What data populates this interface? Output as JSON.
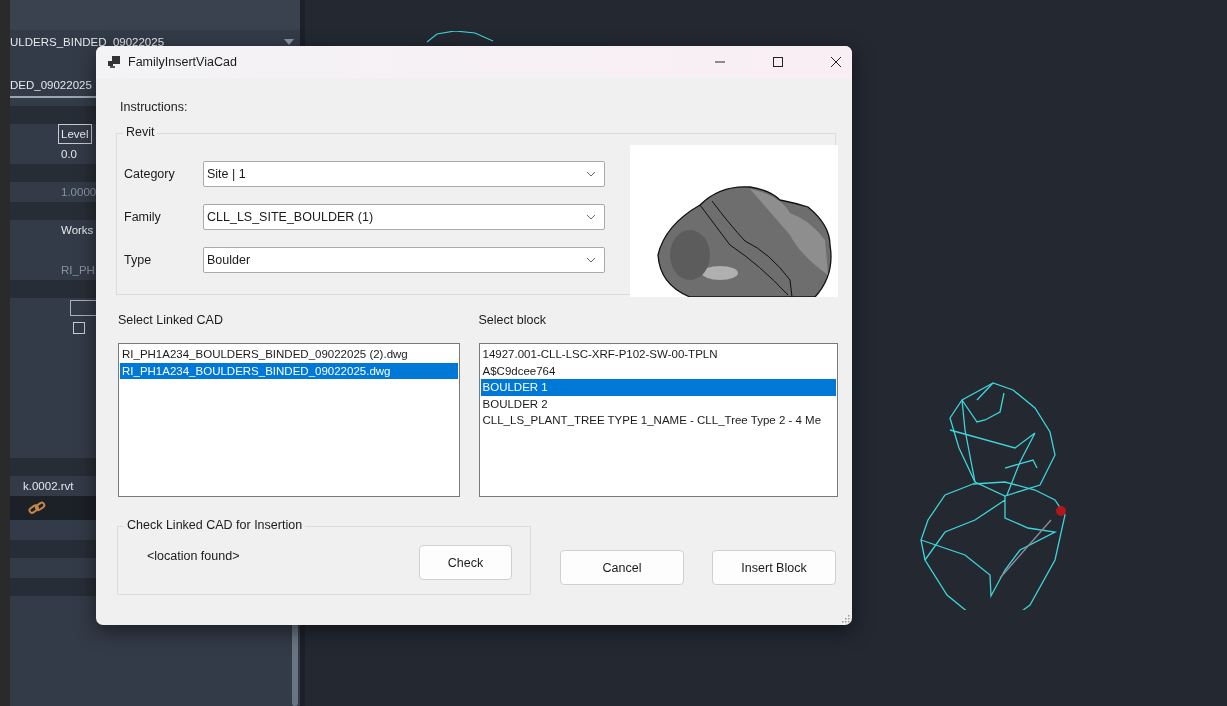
{
  "background_panel": {
    "file_dropdown": "ULDERS_BINDED_09022025",
    "tab": "DED_09022025",
    "properties": [
      {
        "kind": "band"
      },
      {
        "kind": "header",
        "text": "Level"
      },
      {
        "kind": "text",
        "text": "0.0"
      },
      {
        "kind": "band"
      },
      {
        "kind": "dim",
        "text": "1.0000"
      },
      {
        "kind": "band"
      },
      {
        "kind": "text",
        "text": "Works"
      },
      {
        "kind": "empty"
      },
      {
        "kind": "dim",
        "text": "RI_PH"
      },
      {
        "kind": "band"
      },
      {
        "kind": "field"
      },
      {
        "kind": "checkbox",
        "checked": false
      }
    ],
    "link_file": "k.0002.rvt"
  },
  "dialog": {
    "title": "FamilyInsertViaCad",
    "instructions": "Instructions:",
    "revit_group": {
      "title": "Revit",
      "fields": [
        {
          "label": "Category",
          "value": "Site | 1"
        },
        {
          "label": "Family",
          "value": "CLL_LS_SITE_BOULDER (1)"
        },
        {
          "label": "Type",
          "value": "Boulder"
        }
      ]
    },
    "preview": {
      "kind": "picture"
    },
    "linked_cad": {
      "label": "Select Linked CAD",
      "items": [
        {
          "text": "RI_PH1A234_BOULDERS_BINDED_09022025 (2).dwg",
          "selected": false
        },
        {
          "text": "RI_PH1A234_BOULDERS_BINDED_09022025.dwg",
          "selected": true
        }
      ]
    },
    "blocks": {
      "label": "Select block",
      "items": [
        {
          "text": "14927.001-CLL-LSC-XRF-P102-SW-00-TPLN",
          "selected": false
        },
        {
          "text": "A$C9dcee764",
          "selected": false
        },
        {
          "text": "BOULDER 1",
          "selected": true
        },
        {
          "text": "BOULDER 2",
          "selected": false
        },
        {
          "text": "CLL_LS_PLANT_TREE TYPE 1_NAME - CLL_Tree Type 2 - 4 Me",
          "selected": false
        }
      ]
    },
    "check_group": {
      "title": "Check Linked CAD for Insertion",
      "status": "<location found>",
      "button": "Check"
    },
    "buttons": [
      "Cancel",
      "Insert Block"
    ]
  }
}
